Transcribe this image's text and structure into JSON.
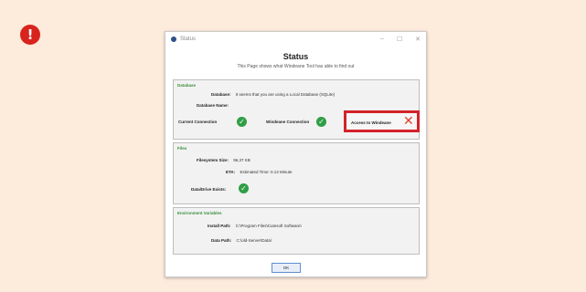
{
  "alert": {
    "glyph": "!",
    "color": "#d9231d"
  },
  "window": {
    "title": "Status",
    "controls": [
      "–",
      "☐",
      "✕"
    ],
    "heading": "Status",
    "subtitle": "This Page shows what Windeane Tool has able to find out",
    "database": {
      "label": "Database",
      "rows": [
        {
          "label": "Database:",
          "value": "It seems that you are using a Local Database (SQLite)"
        },
        {
          "label": "Database Name:",
          "value": ""
        }
      ],
      "current_connection_label": "Current Connection",
      "windeane_connection_label": "Windeane Connection",
      "access_label": "Access to Windeane"
    },
    "files": {
      "label": "Files",
      "rows": [
        {
          "label": "Filesystem Size:",
          "value": "96,37 KB"
        },
        {
          "label": "ETA:",
          "value": "Estimated Time: 0.13 Minute"
        },
        {
          "label": "Data/Drive Exists:",
          "value": ""
        }
      ]
    },
    "environment": {
      "label": "Environment Variables",
      "rows": [
        {
          "label": "Install Path:",
          "value": "C:\\Program Files\\Cutesoft Software\\"
        },
        {
          "label": "Data Path:",
          "value": "C:\\old-Server\\Data\\"
        }
      ]
    },
    "ok_label": "OK"
  }
}
